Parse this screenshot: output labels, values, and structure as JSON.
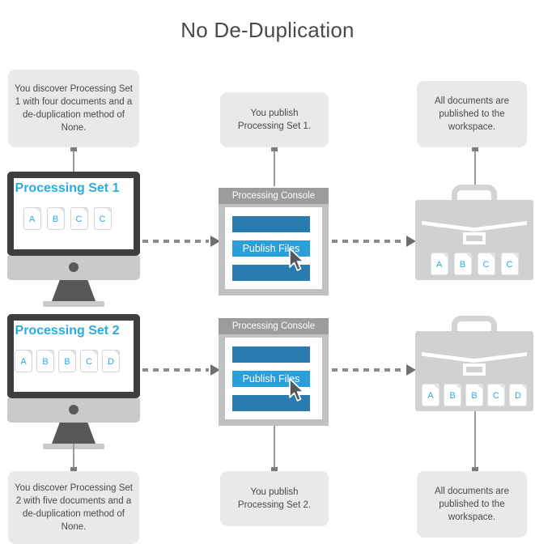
{
  "page": {
    "title": "No De-Duplication",
    "background_color": "#ffffff",
    "title_color": "#4a4a4a",
    "accent_color": "#29abe2",
    "callout_bg_color": "#e9e9e9",
    "connector_color": "#8b8b8b"
  },
  "callouts": {
    "discover_set_1": "You discover Processing Set 1 with four documents and a de-duplication method of None.",
    "publish_set_1": "You publish Processing Set 1.",
    "workspace_1": "All documents are published to the workspace.",
    "discover_set_2": "You discover Processing Set 2 with five documents and a de-duplication method of None.",
    "publish_set_2": "You publish Processing Set 2.",
    "workspace_2": "All documents are published to the workspace."
  },
  "rows": [
    {
      "monitor": {
        "screen_title": "Processing Set 1",
        "documents": [
          "A",
          "B",
          "C",
          "C"
        ]
      },
      "console": {
        "title": "Processing Console",
        "publish_button_label": "Publish Files",
        "bar_color": "#2a7cb0",
        "publish_button_color": "#2b9fd9"
      },
      "workspace": {
        "documents": [
          "A",
          "B",
          "C",
          "C"
        ]
      }
    },
    {
      "monitor": {
        "screen_title": "Processing Set 2",
        "documents": [
          "A",
          "B",
          "B",
          "C",
          "D"
        ]
      },
      "console": {
        "title": "Processing Console",
        "publish_button_label": "Publish Files",
        "bar_color": "#2a7cb0",
        "publish_button_color": "#2b9fd9"
      },
      "workspace": {
        "documents": [
          "A",
          "B",
          "B",
          "C",
          "D"
        ]
      }
    }
  ]
}
